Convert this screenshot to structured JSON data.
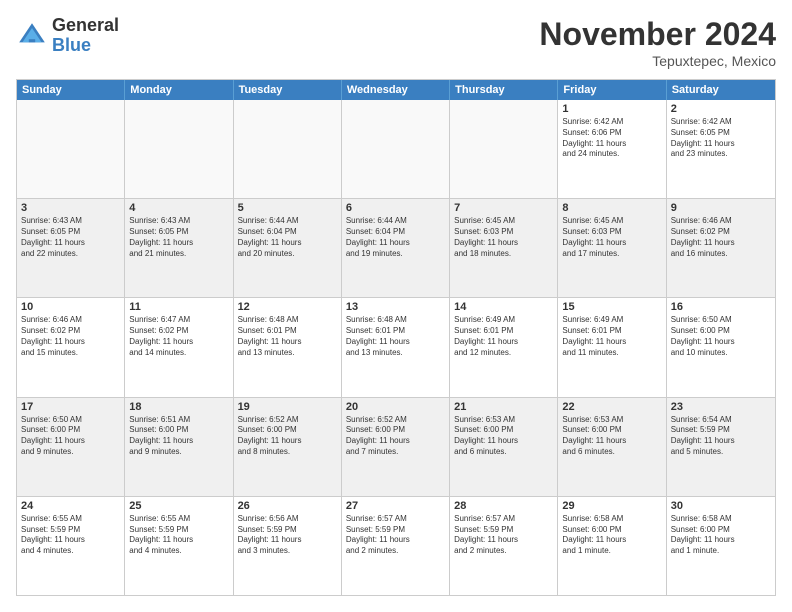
{
  "logo": {
    "general": "General",
    "blue": "Blue"
  },
  "title": "November 2024",
  "location": "Tepuxtepec, Mexico",
  "header_days": [
    "Sunday",
    "Monday",
    "Tuesday",
    "Wednesday",
    "Thursday",
    "Friday",
    "Saturday"
  ],
  "weeks": [
    [
      {
        "day": "",
        "empty": true
      },
      {
        "day": "",
        "empty": true
      },
      {
        "day": "",
        "empty": true
      },
      {
        "day": "",
        "empty": true
      },
      {
        "day": "",
        "empty": true
      },
      {
        "day": "1",
        "lines": [
          "Sunrise: 6:42 AM",
          "Sunset: 6:06 PM",
          "Daylight: 11 hours",
          "and 24 minutes."
        ]
      },
      {
        "day": "2",
        "lines": [
          "Sunrise: 6:42 AM",
          "Sunset: 6:05 PM",
          "Daylight: 11 hours",
          "and 23 minutes."
        ]
      }
    ],
    [
      {
        "day": "3",
        "lines": [
          "Sunrise: 6:43 AM",
          "Sunset: 6:05 PM",
          "Daylight: 11 hours",
          "and 22 minutes."
        ]
      },
      {
        "day": "4",
        "lines": [
          "Sunrise: 6:43 AM",
          "Sunset: 6:05 PM",
          "Daylight: 11 hours",
          "and 21 minutes."
        ]
      },
      {
        "day": "5",
        "lines": [
          "Sunrise: 6:44 AM",
          "Sunset: 6:04 PM",
          "Daylight: 11 hours",
          "and 20 minutes."
        ]
      },
      {
        "day": "6",
        "lines": [
          "Sunrise: 6:44 AM",
          "Sunset: 6:04 PM",
          "Daylight: 11 hours",
          "and 19 minutes."
        ]
      },
      {
        "day": "7",
        "lines": [
          "Sunrise: 6:45 AM",
          "Sunset: 6:03 PM",
          "Daylight: 11 hours",
          "and 18 minutes."
        ]
      },
      {
        "day": "8",
        "lines": [
          "Sunrise: 6:45 AM",
          "Sunset: 6:03 PM",
          "Daylight: 11 hours",
          "and 17 minutes."
        ]
      },
      {
        "day": "9",
        "lines": [
          "Sunrise: 6:46 AM",
          "Sunset: 6:02 PM",
          "Daylight: 11 hours",
          "and 16 minutes."
        ]
      }
    ],
    [
      {
        "day": "10",
        "lines": [
          "Sunrise: 6:46 AM",
          "Sunset: 6:02 PM",
          "Daylight: 11 hours",
          "and 15 minutes."
        ]
      },
      {
        "day": "11",
        "lines": [
          "Sunrise: 6:47 AM",
          "Sunset: 6:02 PM",
          "Daylight: 11 hours",
          "and 14 minutes."
        ]
      },
      {
        "day": "12",
        "lines": [
          "Sunrise: 6:48 AM",
          "Sunset: 6:01 PM",
          "Daylight: 11 hours",
          "and 13 minutes."
        ]
      },
      {
        "day": "13",
        "lines": [
          "Sunrise: 6:48 AM",
          "Sunset: 6:01 PM",
          "Daylight: 11 hours",
          "and 13 minutes."
        ]
      },
      {
        "day": "14",
        "lines": [
          "Sunrise: 6:49 AM",
          "Sunset: 6:01 PM",
          "Daylight: 11 hours",
          "and 12 minutes."
        ]
      },
      {
        "day": "15",
        "lines": [
          "Sunrise: 6:49 AM",
          "Sunset: 6:01 PM",
          "Daylight: 11 hours",
          "and 11 minutes."
        ]
      },
      {
        "day": "16",
        "lines": [
          "Sunrise: 6:50 AM",
          "Sunset: 6:00 PM",
          "Daylight: 11 hours",
          "and 10 minutes."
        ]
      }
    ],
    [
      {
        "day": "17",
        "lines": [
          "Sunrise: 6:50 AM",
          "Sunset: 6:00 PM",
          "Daylight: 11 hours",
          "and 9 minutes."
        ]
      },
      {
        "day": "18",
        "lines": [
          "Sunrise: 6:51 AM",
          "Sunset: 6:00 PM",
          "Daylight: 11 hours",
          "and 9 minutes."
        ]
      },
      {
        "day": "19",
        "lines": [
          "Sunrise: 6:52 AM",
          "Sunset: 6:00 PM",
          "Daylight: 11 hours",
          "and 8 minutes."
        ]
      },
      {
        "day": "20",
        "lines": [
          "Sunrise: 6:52 AM",
          "Sunset: 6:00 PM",
          "Daylight: 11 hours",
          "and 7 minutes."
        ]
      },
      {
        "day": "21",
        "lines": [
          "Sunrise: 6:53 AM",
          "Sunset: 6:00 PM",
          "Daylight: 11 hours",
          "and 6 minutes."
        ]
      },
      {
        "day": "22",
        "lines": [
          "Sunrise: 6:53 AM",
          "Sunset: 6:00 PM",
          "Daylight: 11 hours",
          "and 6 minutes."
        ]
      },
      {
        "day": "23",
        "lines": [
          "Sunrise: 6:54 AM",
          "Sunset: 5:59 PM",
          "Daylight: 11 hours",
          "and 5 minutes."
        ]
      }
    ],
    [
      {
        "day": "24",
        "lines": [
          "Sunrise: 6:55 AM",
          "Sunset: 5:59 PM",
          "Daylight: 11 hours",
          "and 4 minutes."
        ]
      },
      {
        "day": "25",
        "lines": [
          "Sunrise: 6:55 AM",
          "Sunset: 5:59 PM",
          "Daylight: 11 hours",
          "and 4 minutes."
        ]
      },
      {
        "day": "26",
        "lines": [
          "Sunrise: 6:56 AM",
          "Sunset: 5:59 PM",
          "Daylight: 11 hours",
          "and 3 minutes."
        ]
      },
      {
        "day": "27",
        "lines": [
          "Sunrise: 6:57 AM",
          "Sunset: 5:59 PM",
          "Daylight: 11 hours",
          "and 2 minutes."
        ]
      },
      {
        "day": "28",
        "lines": [
          "Sunrise: 6:57 AM",
          "Sunset: 5:59 PM",
          "Daylight: 11 hours",
          "and 2 minutes."
        ]
      },
      {
        "day": "29",
        "lines": [
          "Sunrise: 6:58 AM",
          "Sunset: 6:00 PM",
          "Daylight: 11 hours",
          "and 1 minute."
        ]
      },
      {
        "day": "30",
        "lines": [
          "Sunrise: 6:58 AM",
          "Sunset: 6:00 PM",
          "Daylight: 11 hours",
          "and 1 minute."
        ]
      }
    ]
  ]
}
